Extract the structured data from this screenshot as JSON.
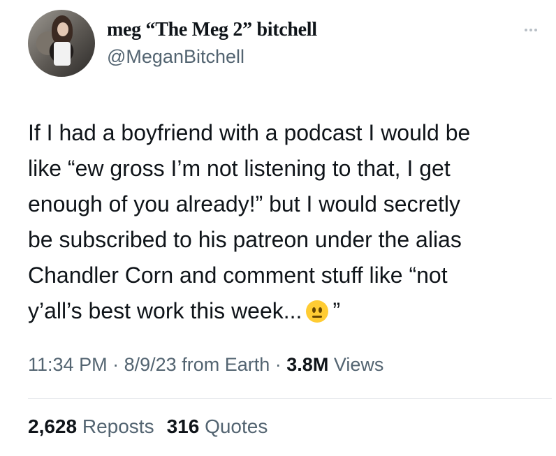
{
  "author": {
    "display_name": "meg “The Meg 2” bitchell",
    "handle": "@MeganBitchell"
  },
  "tweet": {
    "lines": [
      "If I had a boyfriend with a podcast I would be",
      "like “ew gross I’m not listening to that, I get",
      "enough of you already!” but I would secretly",
      "be subscribed to his patreon under the alias",
      "Chandler Corn and comment stuff like “not",
      "y’all’s best work this week..."
    ],
    "closing_quote": "”",
    "emoji": "neutral-face-emoji"
  },
  "meta": {
    "time": "11:34 PM",
    "separator": "·",
    "date": "8/9/23",
    "source": "from Earth",
    "views_count": "3.8M",
    "views_label": "Views"
  },
  "stats": {
    "reposts_count": "2,628",
    "reposts_label": "Reposts",
    "quotes_count": "316",
    "quotes_label": "Quotes"
  },
  "icons": {
    "more": "more-options-icon"
  },
  "colors": {
    "text_primary": "#0f1419",
    "text_secondary": "#536471",
    "divider": "#e6e9ec"
  }
}
